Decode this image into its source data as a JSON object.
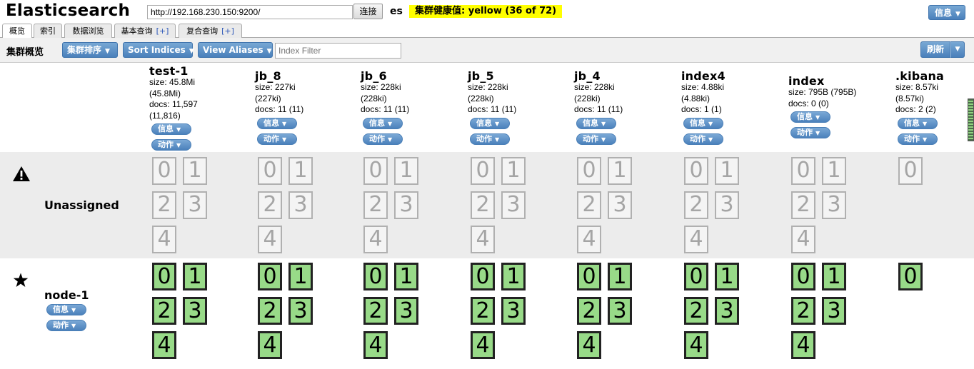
{
  "header": {
    "app_title": "Elasticsearch",
    "url": "http://192.168.230.150:9200/",
    "connect_label": "连接",
    "cluster_name": "es",
    "health_text": "集群健康值: yellow (36 of 72)",
    "health_color": "#ffff00",
    "info_label": "信息"
  },
  "tabs": [
    {
      "label": "概览",
      "plus": ""
    },
    {
      "label": "索引",
      "plus": ""
    },
    {
      "label": "数据浏览",
      "plus": ""
    },
    {
      "label": "基本查询",
      "plus": "[+]"
    },
    {
      "label": "复合查询",
      "plus": "[+]"
    }
  ],
  "toolbar": {
    "overview_label": "集群概览",
    "sort_cluster_label": "集群排序",
    "sort_indices_label": "Sort Indices",
    "view_aliases_label": "View Aliases",
    "filter_placeholder": "Index Filter",
    "refresh_label": "刷新"
  },
  "pill_labels": {
    "info": "信息",
    "action": "动作"
  },
  "indices": [
    {
      "name": "test-1",
      "lines": [
        "size: 45.8Mi",
        "(45.8Mi)",
        "docs: 11,597",
        "(11,816)"
      ],
      "shard_count": 5
    },
    {
      "name": "jb_8",
      "lines": [
        "size: 227ki",
        "(227ki)",
        "docs: 11 (11)"
      ],
      "shard_count": 5
    },
    {
      "name": "jb_6",
      "lines": [
        "size: 228ki",
        "(228ki)",
        "docs: 11 (11)"
      ],
      "shard_count": 5
    },
    {
      "name": "jb_5",
      "lines": [
        "size: 228ki",
        "(228ki)",
        "docs: 11 (11)"
      ],
      "shard_count": 5
    },
    {
      "name": "jb_4",
      "lines": [
        "size: 228ki",
        "(228ki)",
        "docs: 11 (11)"
      ],
      "shard_count": 5
    },
    {
      "name": "index4",
      "lines": [
        "size: 4.88ki",
        "(4.88ki)",
        "docs: 1 (1)"
      ],
      "shard_count": 5
    },
    {
      "name": "index",
      "lines": [
        "size: 795B (795B)",
        "docs: 0 (0)"
      ],
      "shard_count": 5
    },
    {
      "name": ".kibana",
      "lines": [
        "size: 8.57ki",
        "(8.57ki)",
        "docs: 2 (2)"
      ],
      "shard_count": 1
    }
  ],
  "rows": {
    "unassigned_label": "Unassigned",
    "node_label": "node-1"
  },
  "colors": {
    "assigned_shard": "#98da88",
    "unassigned_shard": "#f4f4f4",
    "button": "#5a8dc4",
    "health": "#ffff00"
  }
}
